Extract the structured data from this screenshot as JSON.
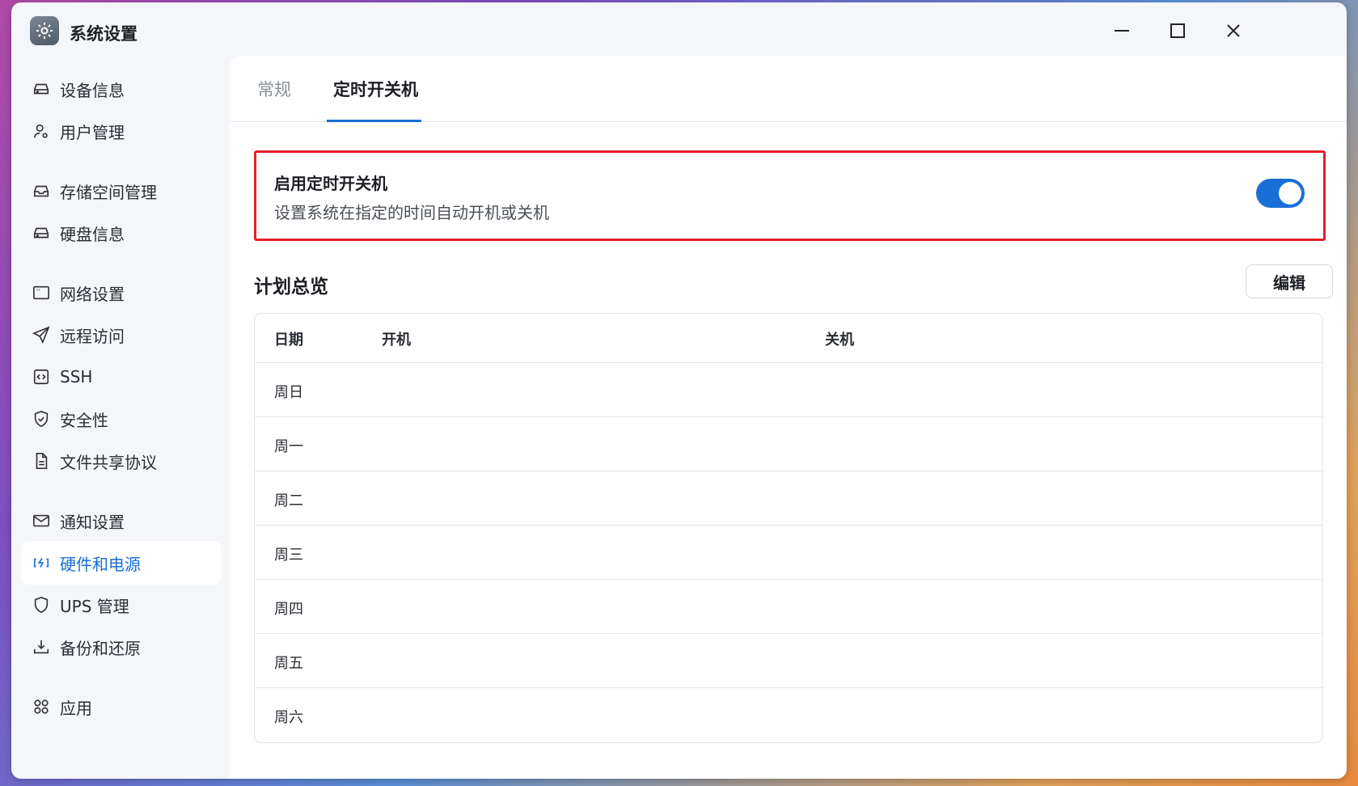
{
  "window": {
    "title": "系统设置"
  },
  "sidebar": {
    "items": [
      {
        "label": "设备信息",
        "icon": "drive-icon"
      },
      {
        "label": "用户管理",
        "icon": "user-gear-icon"
      },
      {
        "label": "存储空间管理",
        "icon": "inbox-icon"
      },
      {
        "label": "硬盘信息",
        "icon": "drive-icon"
      },
      {
        "label": "网络设置",
        "icon": "window-icon"
      },
      {
        "label": "远程访问",
        "icon": "send-icon"
      },
      {
        "label": "SSH",
        "icon": "code-icon"
      },
      {
        "label": "安全性",
        "icon": "shield-check-icon"
      },
      {
        "label": "文件共享协议",
        "icon": "document-icon"
      },
      {
        "label": "通知设置",
        "icon": "mail-icon"
      },
      {
        "label": "硬件和电源",
        "icon": "power-icon",
        "active": true
      },
      {
        "label": "UPS 管理",
        "icon": "shield-icon"
      },
      {
        "label": "备份和还原",
        "icon": "download-icon"
      },
      {
        "label": "应用",
        "icon": "apps-icon"
      }
    ]
  },
  "tabs": [
    {
      "label": "常规",
      "active": false
    },
    {
      "label": "定时开关机",
      "active": true
    }
  ],
  "enable": {
    "title": "启用定时开关机",
    "description": "设置系统在指定的时间自动开机或关机",
    "enabled": true
  },
  "schedule": {
    "title": "计划总览",
    "edit_label": "编辑",
    "columns": [
      "日期",
      "开机",
      "关机"
    ],
    "rows": [
      {
        "day": "周日",
        "on": "",
        "off": ""
      },
      {
        "day": "周一",
        "on": "",
        "off": ""
      },
      {
        "day": "周二",
        "on": "",
        "off": ""
      },
      {
        "day": "周三",
        "on": "",
        "off": ""
      },
      {
        "day": "周四",
        "on": "",
        "off": ""
      },
      {
        "day": "周五",
        "on": "",
        "off": ""
      },
      {
        "day": "周六",
        "on": "",
        "off": ""
      }
    ]
  },
  "colors": {
    "accent": "#1a6fd6",
    "highlight_border": "#e3202a"
  }
}
